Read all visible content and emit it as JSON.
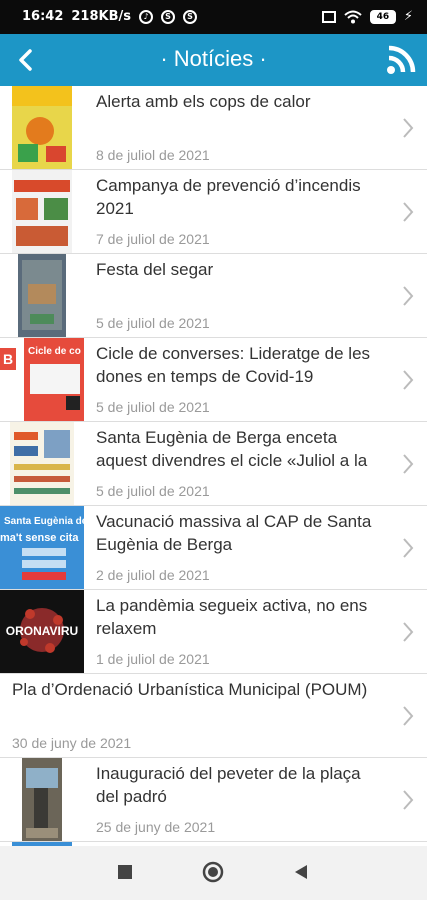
{
  "status": {
    "time": "16:42",
    "speed": "218KB/s",
    "battery": "46"
  },
  "header": {
    "title": "· Notícies ·"
  },
  "news": [
    {
      "title": "Alerta amb els cops de calor",
      "date": "8 de juliol de 2021",
      "thumb": "heat"
    },
    {
      "title": "Campanya de prevenció d’incendis 2021",
      "date": "7 de juliol de 2021",
      "thumb": "fire"
    },
    {
      "title": "Festa del segar",
      "date": "5 de juliol de 2021",
      "thumb": "segar"
    },
    {
      "title": "Cicle de converses: Lideratge de les dones en temps de Covid-19",
      "date": "5 de juliol de 2021",
      "thumb": "cicle"
    },
    {
      "title": "Santa Eugènia de Berga enceta aquest divendres el cicle «Juliol a la",
      "date": "5 de juliol de 2021",
      "thumb": "juliol"
    },
    {
      "title": "Vacunació massiva al CAP de Santa Eugènia de Berga",
      "date": "2 de juliol de 2021",
      "thumb": "vacuna"
    },
    {
      "title": "La pandèmia segueix activa, no ens relaxem",
      "date": "1 de juliol de 2021",
      "thumb": "covid"
    },
    {
      "title": "Pla d’Ordenació Urbanística Municipal (POUM)",
      "date": "30 de juny de 2021",
      "thumb": "none"
    },
    {
      "title": "Inauguració del peveter de la plaça del padró",
      "date": "25 de juny de 2021",
      "thumb": "peveter"
    }
  ],
  "thumb_text": {
    "cicle_b": "B",
    "cicle_title": "Cicle de co",
    "vacuna_title": "Santa Eugènia de",
    "vacuna_sub": "ma't sense cita",
    "covid": "ORONAVIRU"
  },
  "colors": {
    "appbar": "#1d96c6",
    "statusbar": "#0b0b0b",
    "date": "#9a9a9a"
  }
}
